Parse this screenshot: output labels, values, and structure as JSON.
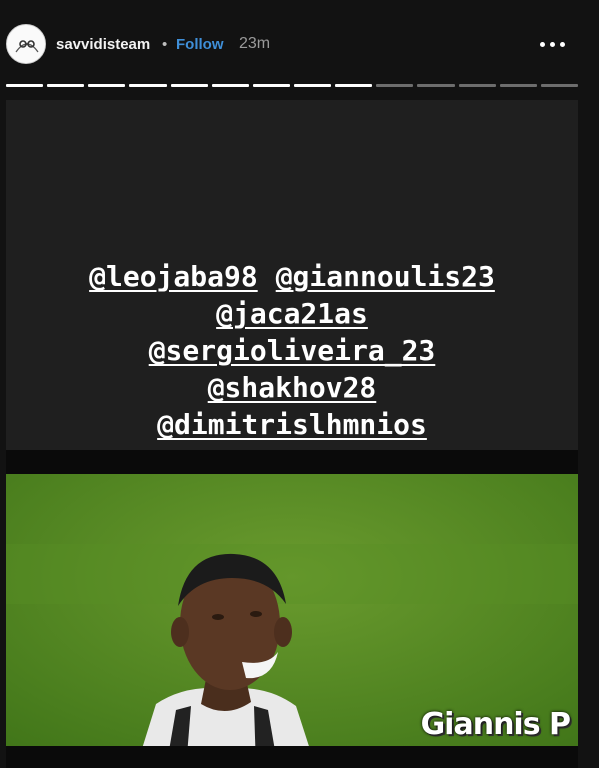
{
  "header": {
    "username": "savvidisteam",
    "separator": "•",
    "follow_label": "Follow",
    "time": "23m",
    "avatar_icon": "avatar-icon",
    "more_icon": "more-options-icon"
  },
  "progress": {
    "total": 14,
    "completed": 9
  },
  "story": {
    "tag_lines": [
      [
        "@leojaba98",
        "@giannoulis23"
      ],
      [
        "@jaca21as"
      ],
      [
        "@sergioliveira_23"
      ],
      [
        "@shakhov28"
      ],
      [
        "@dimitrislhmnios"
      ]
    ],
    "video_watermark": "Giannis P"
  },
  "colors": {
    "background": "#121212",
    "story_bg": "#1f1f1f",
    "follow": "#3f8fd8",
    "pitch": "#4f8a22"
  }
}
